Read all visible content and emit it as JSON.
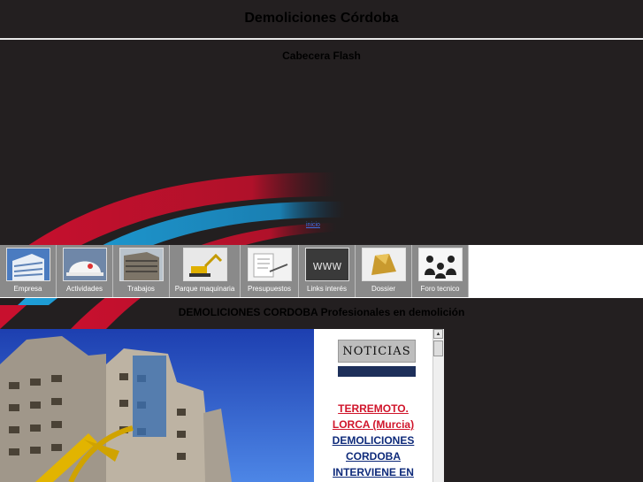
{
  "header": {
    "site_title": "Demoliciones Córdoba",
    "flash_label": "Cabecera Flash",
    "tiny_link": "inicio"
  },
  "nav": {
    "items": [
      {
        "label": "Empresa",
        "icon": "office-building-icon"
      },
      {
        "label": "Actividades",
        "icon": "hard-hat-icon"
      },
      {
        "label": "Trabajos",
        "icon": "demolished-building-icon"
      },
      {
        "label": "Parque maquinaria",
        "icon": "excavator-icon"
      },
      {
        "label": "Presupuestos",
        "icon": "handshake-documents-icon"
      },
      {
        "label": "Links interés",
        "icon": "www-icon"
      },
      {
        "label": "Dossier",
        "icon": "folder-icon"
      },
      {
        "label": "Foro tecnico",
        "icon": "people-forum-icon"
      }
    ]
  },
  "main": {
    "tagline": "DEMOLICIONES CORDOBA Profesionales en demolición"
  },
  "news": {
    "heading": "NOTICIAS",
    "headline_red_1": "TERREMOTO.",
    "headline_red_2": "LORCA (Murcia)",
    "headline_blue_1": "DEMOLICIONES",
    "headline_blue_2": "CORDOBA",
    "headline_blue_3": "INTERVIENE EN"
  },
  "colors": {
    "background": "#231f20",
    "wave_red": "#c8102e",
    "wave_blue": "#1e9fd8",
    "nav_bg": "#8a8a8a",
    "news_red": "#d0152b",
    "news_blue": "#0e2a7a"
  }
}
